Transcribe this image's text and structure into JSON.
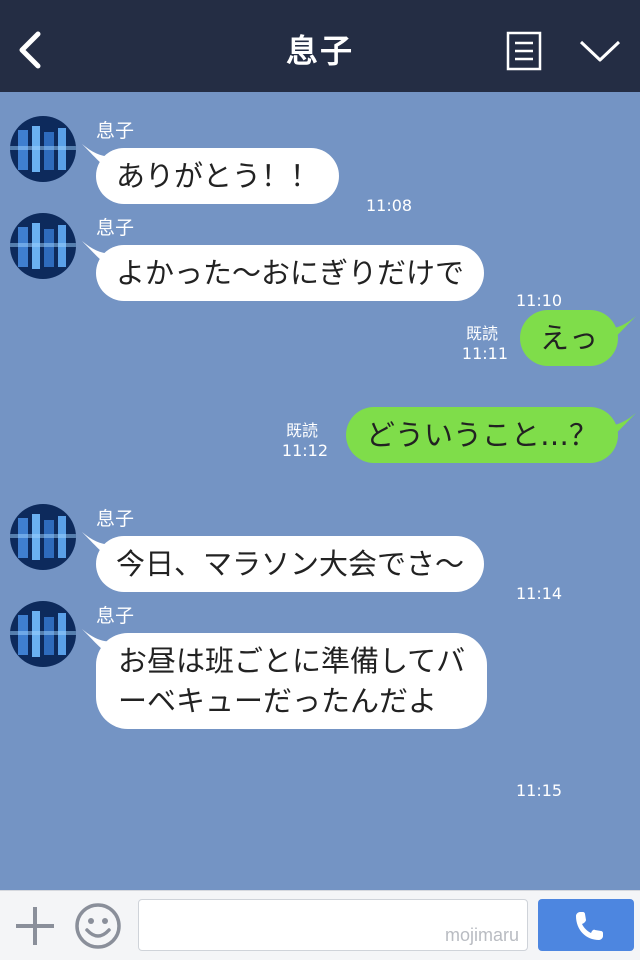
{
  "header": {
    "title": "息子"
  },
  "messages": [
    {
      "sender": "息子",
      "text": "ありがとう！！",
      "time": "11:08"
    },
    {
      "sender": "息子",
      "text": "よかった〜おにぎりだけで",
      "time": "11:10"
    },
    {
      "read": "既読",
      "text": "えっ",
      "time": "11:11"
    },
    {
      "read": "既読",
      "text": "どういうこと…？",
      "time": "11:12"
    },
    {
      "sender": "息子",
      "text": "今日、マラソン大会でさ〜",
      "time": "11:14"
    },
    {
      "sender": "息子",
      "line1": "お昼は班ごとに準備してバ",
      "line2": "ーベキューだったんだよ",
      "time": "11:15"
    }
  ],
  "footer": {
    "input_value": "",
    "watermark": "mojimaru"
  },
  "colors": {
    "header_bg": "#242d44",
    "chat_bg": "#7494c4",
    "bubble_in": "#ffffff",
    "bubble_out": "#7fdd4a",
    "call_button": "#4d86e0"
  },
  "icons": {
    "back": "chevron-left-icon",
    "menu": "document-menu-icon",
    "collapse": "chevron-down-icon",
    "add": "plus-icon",
    "emoji": "smiley-icon",
    "call": "phone-icon"
  }
}
